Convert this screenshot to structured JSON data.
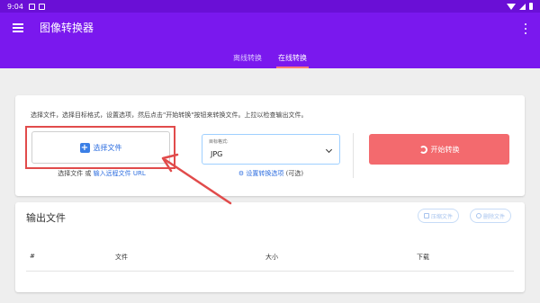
{
  "status_bar": {
    "time": "9:04"
  },
  "app_bar": {
    "title": "图像转换器"
  },
  "tabs": [
    {
      "label": "离线转换"
    },
    {
      "label": "在线转换"
    }
  ],
  "converter": {
    "instructions": "选择文件，选择目标格式，设置选项，然后点击\"开始转换\"按钮来转换文件。上拉以检查输出文件。",
    "select_button": "选择文件",
    "select_hint_prefix": "选择文件 或 ",
    "select_hint_link": "输入远程文件 URL",
    "format_label": "目标格式:",
    "format_value": "JPG",
    "settings_link": "设置转换选项",
    "settings_optional": " (可选)",
    "convert_button": "开始转换"
  },
  "output": {
    "title": "输出文件",
    "compress_button": "压缩文件",
    "delete_button": "删除文件",
    "columns": [
      "#",
      "文件",
      "大小",
      "下载"
    ]
  },
  "colors": {
    "status_bar": "#6a0fd6",
    "app_bar": "#7a18ee",
    "tab_indicator": "#ff7a7a",
    "convert_button": "#f36a6e",
    "link": "#2f6fe0",
    "annotation": "#e14b4b"
  }
}
